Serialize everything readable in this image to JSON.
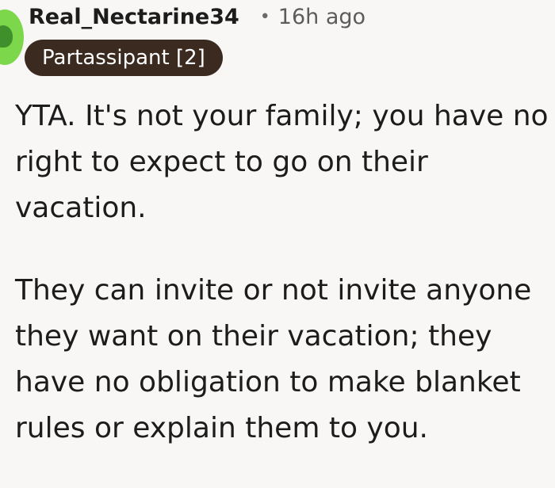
{
  "comment": {
    "username": "Real_Nectarine34",
    "separator": "•",
    "timestamp": "16h ago",
    "flair": "Partassipant [2]",
    "paragraphs": [
      "YTA. It's not your family; you have no right to expect to go on their vacation.",
      "They can invite or not invite anyone they want on their vacation; they have no obligation to make blanket rules or explain them to you."
    ]
  },
  "colors": {
    "background": "#f8f7f5",
    "avatar_bg": "#7cd74b",
    "flair_bg": "#3b2a20",
    "flair_text": "#ffffff"
  }
}
